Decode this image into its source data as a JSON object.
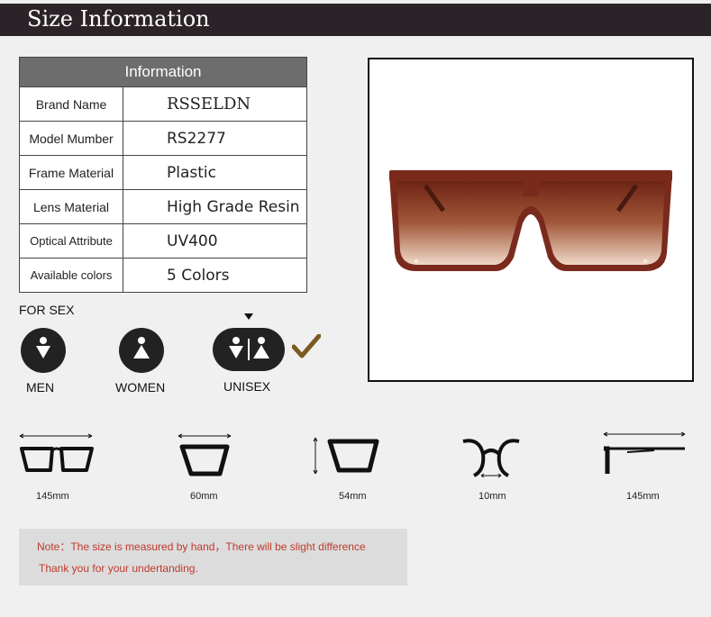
{
  "header": {
    "title": "Size Information"
  },
  "info": {
    "heading": "Information",
    "rows": [
      {
        "label": "Brand Name",
        "value": "RSSELDN"
      },
      {
        "label": "Model Mumber",
        "value": "RS2277"
      },
      {
        "label": "Frame Material",
        "value": "Plastic"
      },
      {
        "label": "Lens Material",
        "value": "High Grade Resin"
      },
      {
        "label": "Optical Attribute",
        "value": "UV400"
      },
      {
        "label": "Available colors",
        "value": "5 Colors"
      }
    ]
  },
  "sex": {
    "heading": "FOR SEX",
    "options": [
      {
        "label": "MEN",
        "icon": "male-icon"
      },
      {
        "label": "WOMEN",
        "icon": "female-icon"
      },
      {
        "label": "UNISEX",
        "icon": "unisex-icon",
        "selected": true
      }
    ]
  },
  "measurements": [
    {
      "label": "145mm",
      "icon": "lens-width-icon"
    },
    {
      "label": "60mm",
      "icon": "lens-width-icon"
    },
    {
      "label": "54mm",
      "icon": "lens-height-icon"
    },
    {
      "label": "10mm",
      "icon": "bridge-width-icon"
    },
    {
      "label": "145mm",
      "icon": "temple-length-icon"
    }
  ],
  "note": {
    "line1": "Note：The size is measured by hand，There will be slight difference",
    "line2": "Thank you for your undertanding."
  },
  "colors": {
    "header_bg": "#2b2328",
    "frame": "#7a2a1c",
    "note_text": "#c0392b",
    "check": "#7a5a20"
  }
}
